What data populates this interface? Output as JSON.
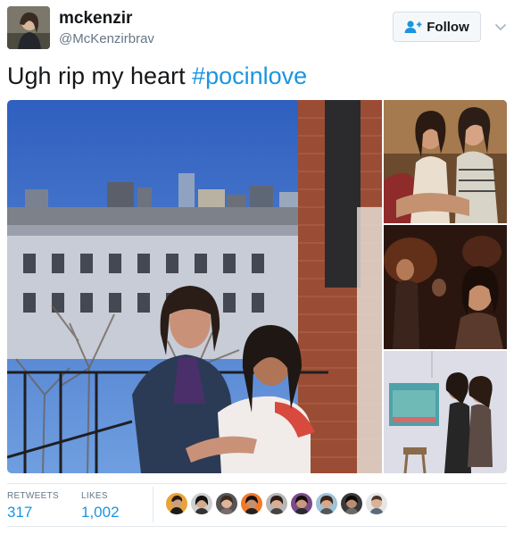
{
  "header": {
    "name": "mckenzir",
    "handle": "@McKenzirbrav",
    "follow_label": "Follow"
  },
  "tweet": {
    "text": "Ugh rip my heart ",
    "hashtag": "#pocinlove"
  },
  "stats": {
    "retweets_label": "RETWEETS",
    "retweets_value": "317",
    "likes_label": "LIKES",
    "likes_value": "1,002"
  },
  "colors": {
    "link": "#1b95e0",
    "text_primary": "#14171a",
    "text_secondary": "#657786",
    "divider": "#e1e8ed"
  },
  "icons": {
    "follow": "person-plus-icon",
    "more": "chevron-down-icon"
  }
}
